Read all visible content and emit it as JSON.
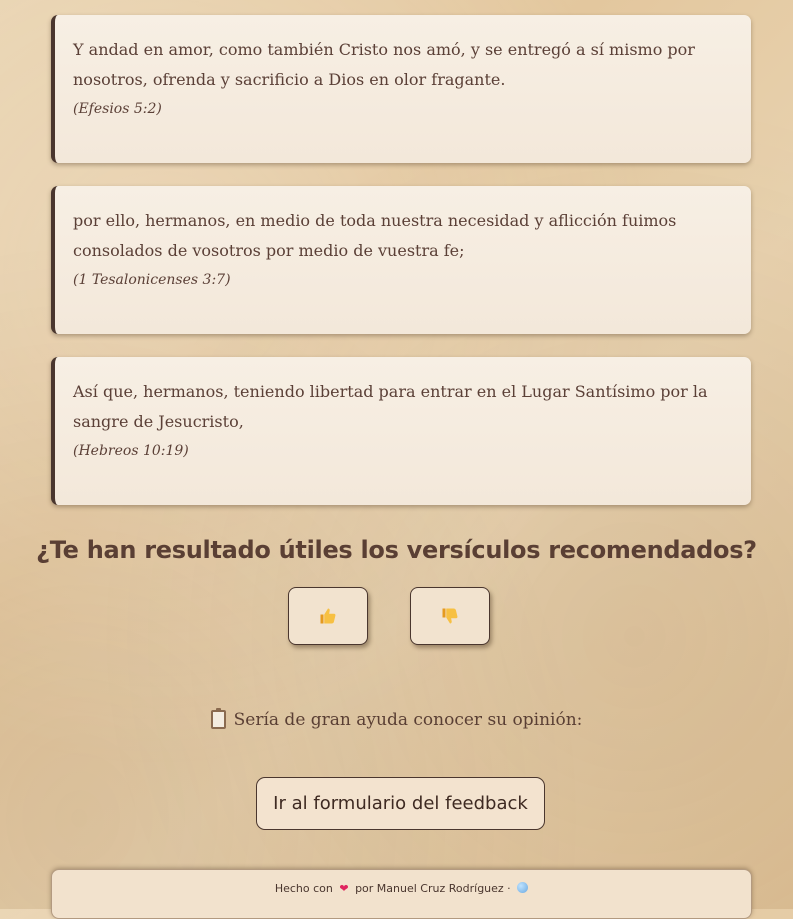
{
  "verses": [
    {
      "text": "Y andad en amor, como también Cristo nos amó, y se entregó a sí mismo por nosotros, ofrenda y sacrificio a Dios en olor fragante.",
      "reference": "(Efesios 5:2)"
    },
    {
      "text": "por ello, hermanos, en medio de toda nuestra necesidad y aflicción fuimos consolados de vosotros por medio de vuestra fe;",
      "reference": "(1 Tesalonicenses 3:7)"
    },
    {
      "text": "Así que, hermanos, teniendo libertad para entrar en el Lugar Santísimo por la sangre de Jesucristo,",
      "reference": "(Hebreos 10:19)"
    }
  ],
  "feedback": {
    "question": "¿Te han resultado útiles los versículos recomendados?",
    "thumbs_up_icon": "thumbs-up-icon",
    "thumbs_down_icon": "thumbs-down-icon",
    "opinion_text": "Sería de gran ayuda conocer su opinión:",
    "opinion_icon": "clipboard-icon",
    "form_button_label": "Ir al formulario del feedback"
  },
  "footer": {
    "made_with": "Hecho con",
    "author_text": "por Manuel Cruz Rodríguez ·",
    "heart_icon": "heart-icon",
    "globe_icon": "globe-icon"
  },
  "colors": {
    "card_accent": "#4a362e",
    "text": "#5a3f34",
    "heart": "#e0245e"
  }
}
